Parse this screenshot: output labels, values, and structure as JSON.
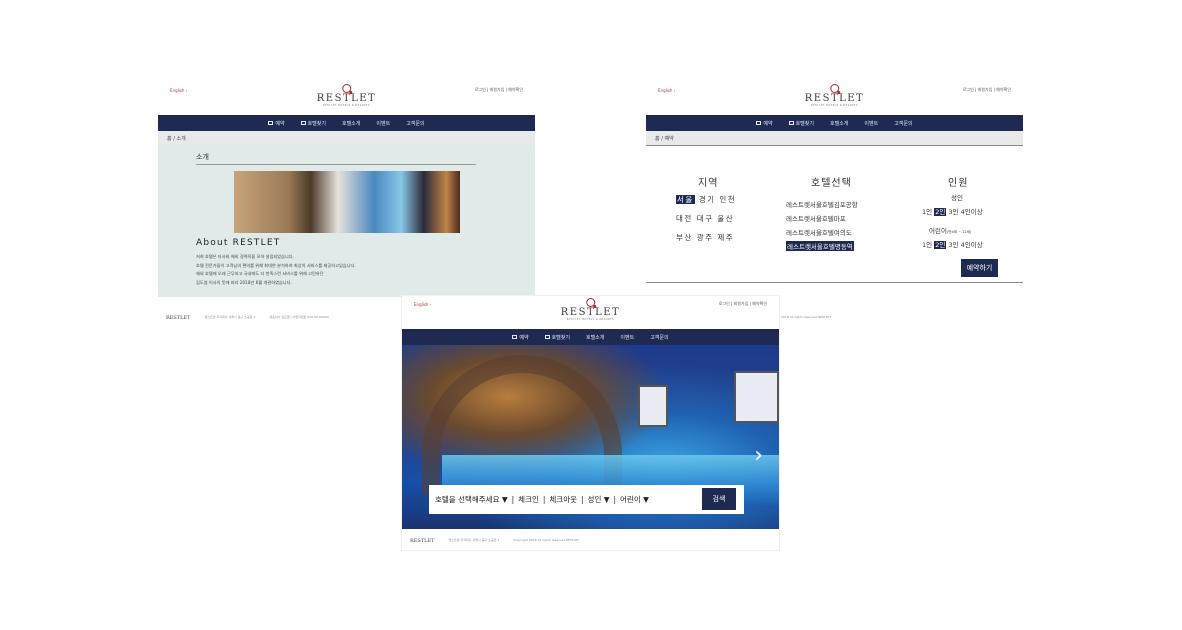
{
  "common": {
    "lang": "English ›",
    "util": "로그인 | 회원가입 | 예약확인",
    "logo": "RESTLET",
    "logo_sub": "RESTLET HOTELS & RESORTS",
    "nav": [
      "예약",
      "호텔찾기",
      "호텔소개",
      "이벤트",
      "고객문의"
    ],
    "footer_cols": [
      "레스트렛 주식회사 서울시 중구 소공로 1",
      "대표이사 김도엽 | 사업자번호 000-00-00000",
      "통신판매업 신고번호 제 2018-서울중구-0000",
      "Copyright 2018 All rights reserved RESTLET"
    ]
  },
  "about": {
    "breadcrumb": "홈 / 소개",
    "section_label": "소개",
    "title": "About RESTLET",
    "lines": [
      "저희 호텔은 타사와 해외 경력직을 모아 설립되었습니다.",
      "호텔 전문가들이 고객님의 편의를 위해 최대한 분석하여 최상의 서비스를 제공하고있습니다.",
      "해외 호텔에 오래 근무하고 국내에도 더 만족스런 서비스를 위해 고민하던",
      "김도엽 이사의 뜻에 따라 2018년 6월 개관하였습니다."
    ]
  },
  "booking": {
    "breadcrumb": "홈 / 예약",
    "region_header": "지역",
    "regions": [
      [
        "서울",
        "경기",
        "인천"
      ],
      [
        "대전",
        "대구",
        "울산"
      ],
      [
        "부산",
        "광주",
        "제주"
      ]
    ],
    "region_selected": "서울",
    "hotel_header": "호텔선택",
    "hotels": [
      "레스트렛서울호텔김포공항",
      "레스트렛서울호텔마포",
      "레스트렛서울호텔여의도",
      "레스트렛서울호텔명동역"
    ],
    "hotel_selected_index": 3,
    "people_header": "인원",
    "adult_label": "성인",
    "adult_options": [
      "1인",
      "2인",
      "3인",
      "4인이상"
    ],
    "adult_selected": "2인",
    "child_label": "어린이",
    "child_note": "(만4세 ~ 12세)",
    "child_options": [
      "1인",
      "2인",
      "3인",
      "4인이상"
    ],
    "child_selected": "2인",
    "reserve_button": "예약하기"
  },
  "home": {
    "hotel_select": "호텔을 선택해주세요 ▼",
    "checkin": "체크인",
    "checkout": "체크아웃",
    "adult": "성인 ▼",
    "child": "어린이 ▼",
    "search_button": "검색",
    "next_arrow": "›"
  }
}
